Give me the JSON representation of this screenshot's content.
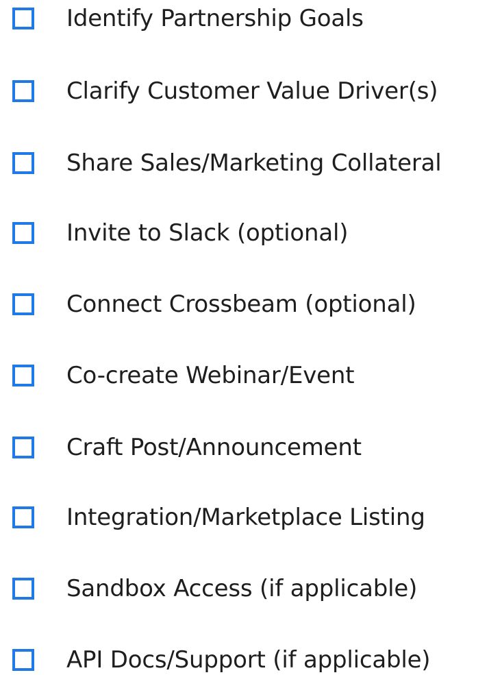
{
  "accent_color": "#1f7ae8",
  "text_color": "#1e1e1e",
  "checklist": {
    "items": [
      {
        "label": "Identify Partnership Goals",
        "checked": false
      },
      {
        "label": "Clarify Customer Value Driver(s)",
        "checked": false
      },
      {
        "label": "Share Sales/Marketing Collateral",
        "checked": false
      },
      {
        "label": "Invite to Slack (optional)",
        "checked": false
      },
      {
        "label": "Connect Crossbeam (optional)",
        "checked": false
      },
      {
        "label": "Co-create Webinar/Event",
        "checked": false
      },
      {
        "label": "Craft Post/Announcement",
        "checked": false
      },
      {
        "label": "Integration/Marketplace Listing",
        "checked": false
      },
      {
        "label": "Sandbox Access (if applicable)",
        "checked": false
      },
      {
        "label": "API Docs/Support (if applicable)",
        "checked": false
      }
    ]
  }
}
